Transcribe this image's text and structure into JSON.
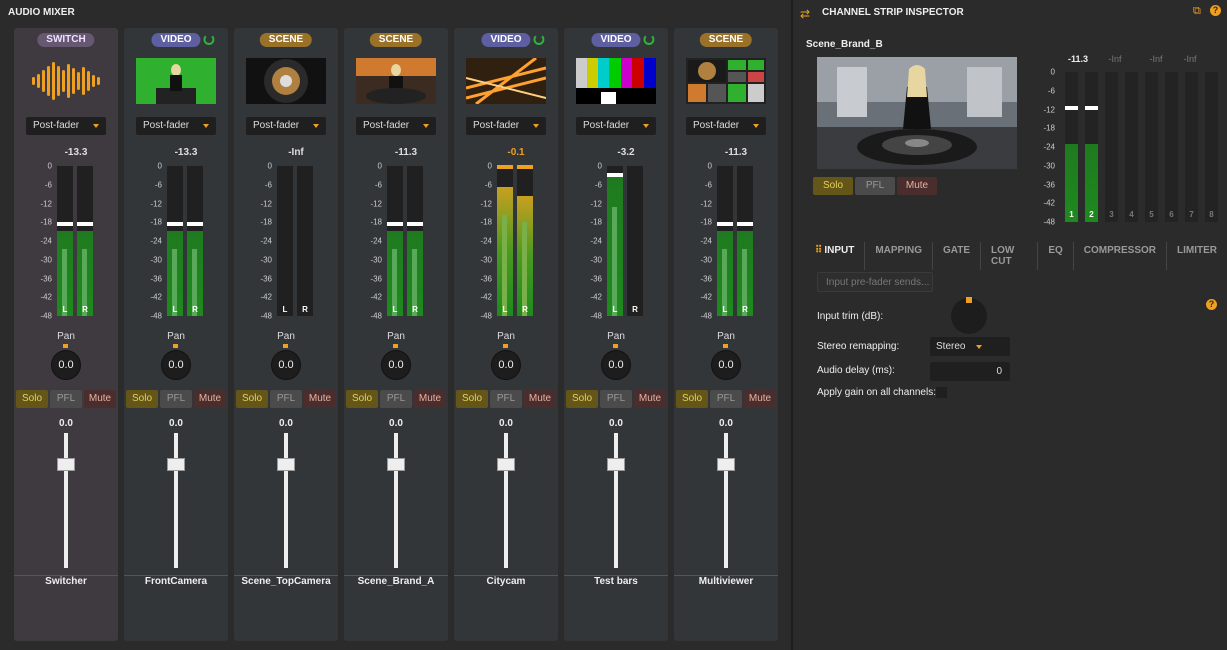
{
  "mixer": {
    "title": "AUDIO MIXER"
  },
  "scale_labels": [
    "0",
    "-6",
    "-12",
    "-18",
    "-24",
    "-30",
    "-36",
    "-42",
    "-48"
  ],
  "strip_ui": {
    "pan_label": "Pan",
    "solo": "Solo",
    "pfl": "PFL",
    "mute": "Mute",
    "lr": [
      "L",
      "R"
    ]
  },
  "strips": [
    {
      "badge": "SWITCH",
      "kind": "sw",
      "selected": true,
      "send": "Post-fader",
      "db": "-13.3",
      "pan": "0.0",
      "fader": "0.0",
      "name": "Switcher",
      "meter_l": 0.57,
      "meter_r": 0.57,
      "peak_l": 0.6,
      "peak_r": 0.6,
      "warn": false
    },
    {
      "badge": "VIDEO",
      "kind": "video",
      "live_icon": "recycle-icon",
      "send": "Post-fader",
      "db": "-13.3",
      "pan": "0.0",
      "fader": "0.0",
      "name": "FrontCamera",
      "meter_l": 0.57,
      "meter_r": 0.57,
      "peak_l": 0.6,
      "peak_r": 0.6,
      "warn": false
    },
    {
      "badge": "SCENE",
      "kind": "scene",
      "send": "Post-fader",
      "db": "-Inf",
      "pan": "0.0",
      "fader": "0.0",
      "name": "Scene_TopCamera",
      "meter_l": 0,
      "meter_r": 0,
      "peak_l": -1,
      "peak_r": -1,
      "warn": false
    },
    {
      "badge": "SCENE",
      "kind": "scene",
      "send": "Post-fader",
      "db": "-11.3",
      "pan": "0.0",
      "fader": "0.0",
      "name": "Scene_Brand_A",
      "meter_l": 0.57,
      "meter_r": 0.57,
      "peak_l": 0.6,
      "peak_r": 0.6,
      "warn": false
    },
    {
      "badge": "VIDEO",
      "kind": "video",
      "live_icon": "recycle-icon",
      "send": "Post-fader",
      "db": "-0.1",
      "pan": "0.0",
      "fader": "0.0",
      "name": "Citycam",
      "meter_l": 0.86,
      "meter_r": 0.8,
      "peak_l": 0.98,
      "peak_r": 0.98,
      "warn": true
    },
    {
      "badge": "VIDEO",
      "kind": "video",
      "live_icon": "recycle-icon",
      "send": "Post-fader",
      "db": "-3.2",
      "pan": "0.0",
      "fader": "0.0",
      "name": "Test bars",
      "meter_l": 0.93,
      "meter_r": 0,
      "peak_l": 0.93,
      "peak_r": -1,
      "warn": false
    },
    {
      "badge": "SCENE",
      "kind": "scene",
      "send": "Post-fader",
      "db": "-11.3",
      "pan": "0.0",
      "fader": "0.0",
      "name": "Multiviewer",
      "meter_l": 0.57,
      "meter_r": 0.57,
      "peak_l": 0.6,
      "peak_r": 0.6,
      "warn": false
    }
  ],
  "inspector": {
    "title": "CHANNEL STRIP INSPECTOR",
    "channel_name": "Scene_Brand_B",
    "solo": "Solo",
    "pfl": "PFL",
    "mute": "Mute",
    "meter_db": [
      "-11.3",
      "-Inf",
      "-Inf",
      "-Inf"
    ],
    "meter_scale": [
      "0",
      "-6",
      "-12",
      "-18",
      "-24",
      "-30",
      "-36",
      "-42",
      "-48"
    ],
    "meter_channels": [
      "1",
      "2",
      "3",
      "4",
      "5",
      "6",
      "7",
      "8"
    ],
    "tabs": [
      "INPUT",
      "MAPPING",
      "GATE",
      "LOW CUT",
      "EQ",
      "COMPRESSOR",
      "LIMITER"
    ],
    "active_tab": "INPUT",
    "prefader_button": "Input pre-fader sends...",
    "trim_label": "Input trim (dB):",
    "remap_label": "Stereo remapping:",
    "remap_value": "Stereo",
    "delay_label": "Audio delay (ms):",
    "delay_value": "0",
    "apply_gain_label": "Apply gain on all channels:"
  },
  "colors": {
    "accent": "#f0a020",
    "meter_green": "#1e8a1e",
    "solo": "#645618",
    "mute": "#4a2e2e"
  }
}
